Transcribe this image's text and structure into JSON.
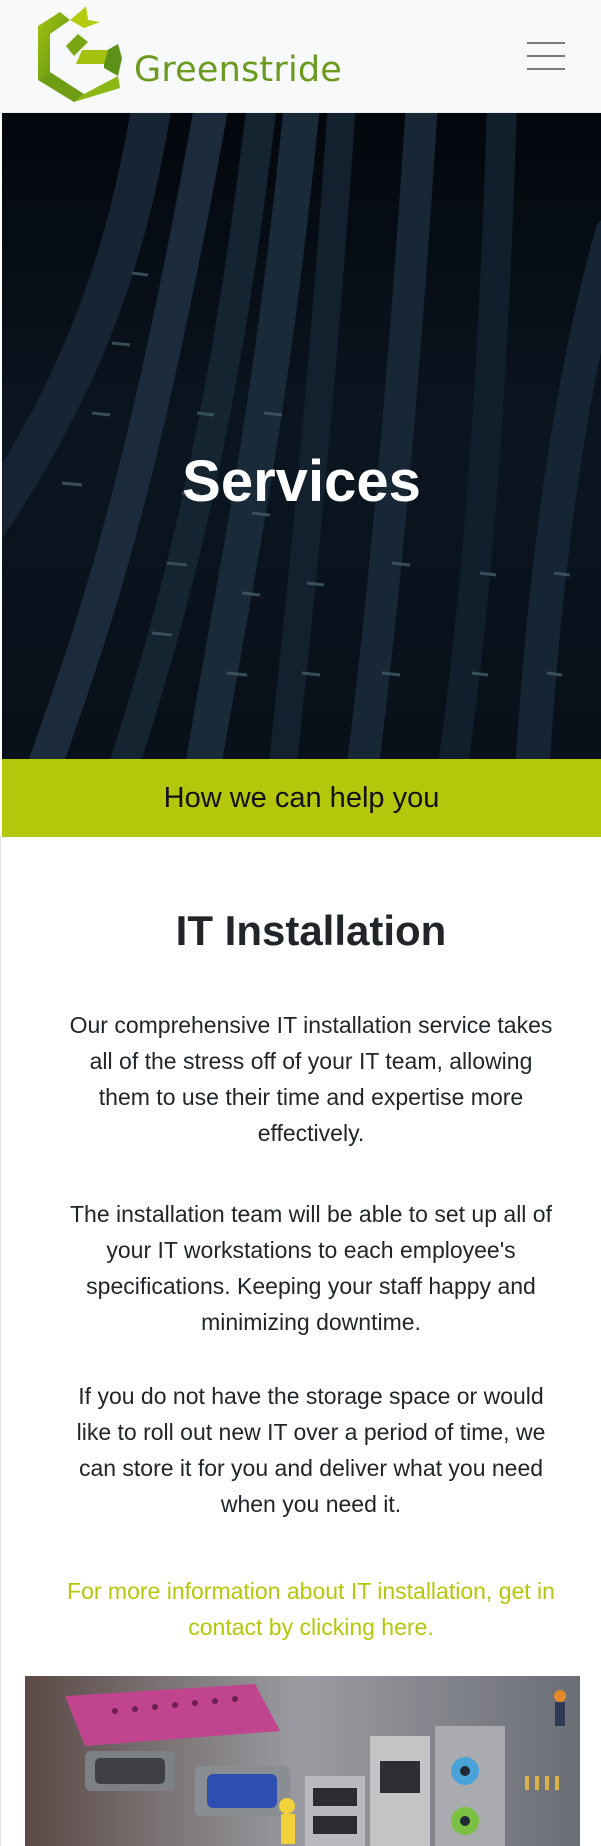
{
  "header": {
    "brand_name": "Greenstride",
    "menu_icon": "hamburger-menu-icon"
  },
  "hero": {
    "title": "Services"
  },
  "band": {
    "text": "How we can help you"
  },
  "section": {
    "title": "IT Installation",
    "paragraphs": [
      "Our comprehensive IT installation service takes all of the stress off of your IT team, allowing them to use their time and expertise more effectively.",
      "The installation team will be able to set up all of your IT workstations to each employee's specifications. Keeping your staff happy and minimizing downtime.",
      "If you do not have the storage space or would like to roll out new IT over a period of time, we can store it for you and deliver what you need when you need it."
    ],
    "contact_link": "For more information about IT installation, get in contact by clicking here."
  },
  "colors": {
    "accent": "#b5c70a",
    "brand_text": "#6a9a1e",
    "navbar_bg": "#f8f9fa"
  }
}
